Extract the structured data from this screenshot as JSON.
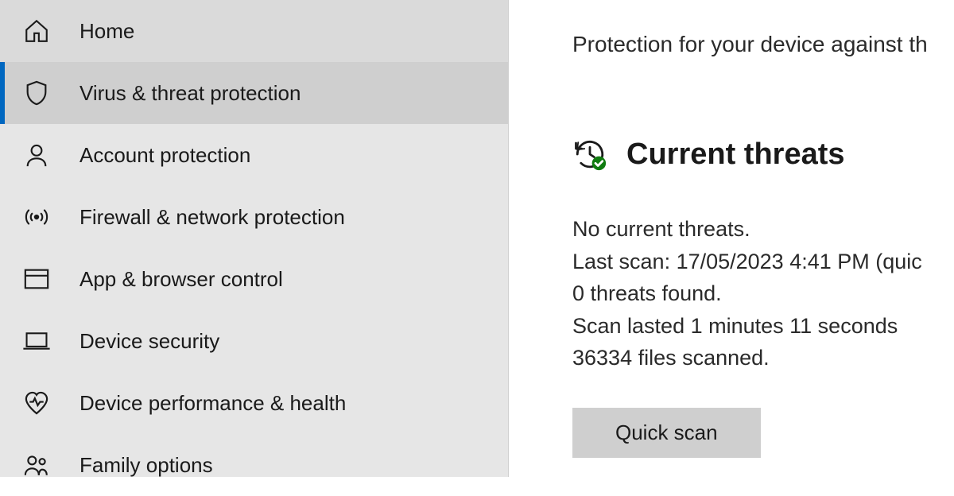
{
  "sidebar": {
    "items": [
      {
        "label": "Home"
      },
      {
        "label": "Virus & threat protection"
      },
      {
        "label": "Account protection"
      },
      {
        "label": "Firewall & network protection"
      },
      {
        "label": "App & browser control"
      },
      {
        "label": "Device security"
      },
      {
        "label": "Device performance & health"
      },
      {
        "label": "Family options"
      }
    ],
    "active_index": 1
  },
  "main": {
    "page_subtitle": "Protection for your device against th",
    "section_title": "Current threats",
    "status": {
      "no_threats": "No current threats.",
      "last_scan": "Last scan: 17/05/2023 4:41 PM (quic",
      "threats_found": "0 threats found.",
      "duration": "Scan lasted 1 minutes 11 seconds",
      "files_scanned": "36334 files scanned."
    },
    "quick_scan_label": "Quick scan"
  }
}
